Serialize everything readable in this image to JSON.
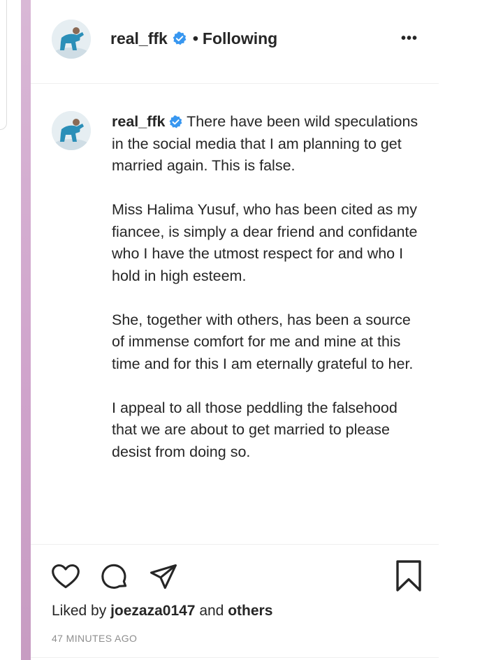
{
  "header": {
    "username": "real_ffk",
    "separator": "•",
    "follow_status": "Following",
    "more_label": "•••"
  },
  "caption": {
    "username": "real_ffk",
    "paragraphs": [
      "There have been wild speculations in the social media that I am planning to get married again. This is false.",
      "Miss Halima Yusuf, who has been cited as my fiancee, is simply a dear friend and confidante who I have the utmost respect for and who I hold in high esteem.",
      "She, together with others, has been a source of immense comfort for me and mine at this time and for this I am eternally grateful to her.",
      "I appeal to all those peddling the falsehood that we are about to get married to please desist from doing so."
    ]
  },
  "actions": {
    "like_icon": "heart-icon",
    "comment_icon": "comment-bubble-icon",
    "share_icon": "paper-plane-icon",
    "save_icon": "bookmark-icon"
  },
  "likes": {
    "prefix": "Liked by",
    "user": "joezaza0147",
    "connector": "and",
    "others": "others"
  },
  "timestamp": "47 MINUTES AGO",
  "colors": {
    "verified_badge": "#3897f0",
    "text": "#262626",
    "muted": "#8e8e8e",
    "side_bar": "#d2a9cf"
  }
}
